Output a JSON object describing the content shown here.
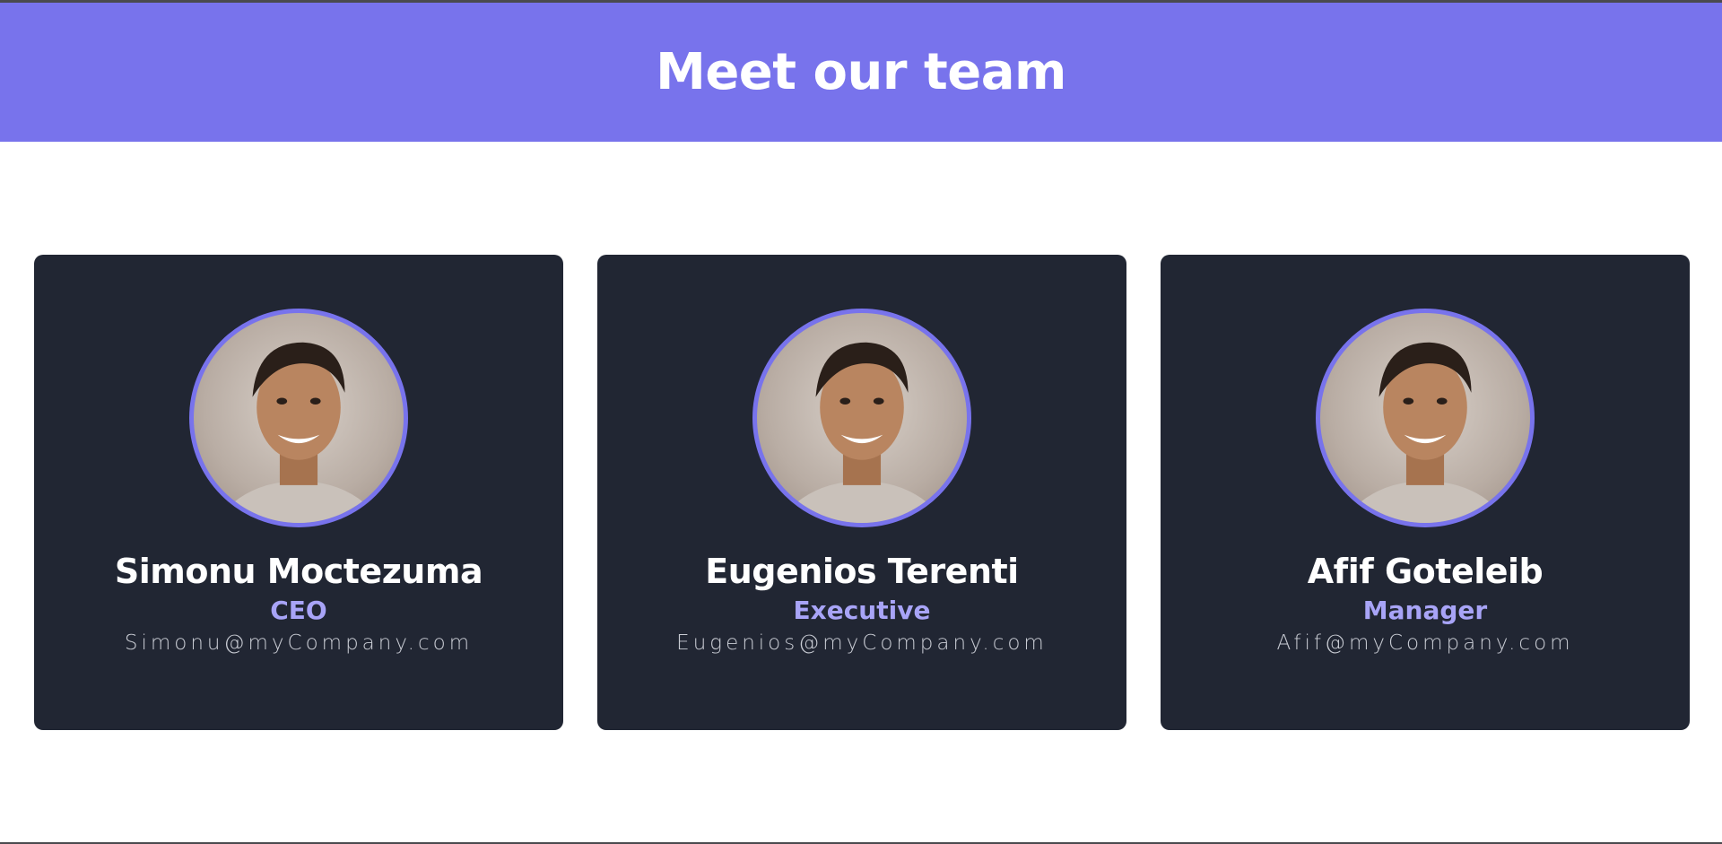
{
  "header": {
    "title": "Meet our team"
  },
  "colors": {
    "header_bg": "#7873ec",
    "card_bg": "#212633",
    "accent": "#7873ec",
    "role_text": "#a8a4f7"
  },
  "members": [
    {
      "name": "Simonu Moctezuma",
      "role": "CEO",
      "email": "Simonu@myCompany.com",
      "photo": "portrait-photo"
    },
    {
      "name": "Eugenios Terenti",
      "role": "Executive",
      "email": "Eugenios@myCompany.com",
      "photo": "portrait-photo"
    },
    {
      "name": "Afif Goteleib",
      "role": "Manager",
      "email": "Afif@myCompany.com",
      "photo": "portrait-photo"
    }
  ]
}
